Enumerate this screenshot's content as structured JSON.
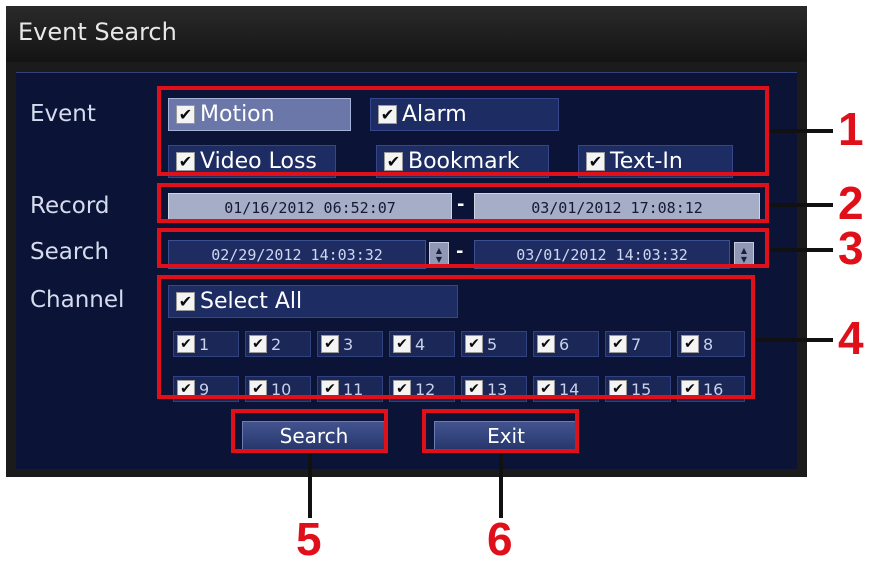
{
  "window": {
    "title": "Event Search"
  },
  "labels": {
    "event": "Event",
    "record": "Record",
    "search": "Search",
    "channel": "Channel"
  },
  "event_types": [
    {
      "label": "Motion",
      "checked": true,
      "selected": true
    },
    {
      "label": "Alarm",
      "checked": true
    },
    {
      "label": "Video Loss",
      "checked": true
    },
    {
      "label": "Bookmark",
      "checked": true
    },
    {
      "label": "Text-In",
      "checked": true
    }
  ],
  "record": {
    "start": "01/16/2012 06:52:07",
    "separator": "-",
    "end": "03/01/2012 17:08:12"
  },
  "search_range": {
    "start": "02/29/2012 14:03:32",
    "separator": "-",
    "end": "03/01/2012 14:03:32"
  },
  "channels": {
    "select_all": "Select All",
    "items": [
      "1",
      "2",
      "3",
      "4",
      "5",
      "6",
      "7",
      "8",
      "9",
      "10",
      "11",
      "12",
      "13",
      "14",
      "15",
      "16"
    ]
  },
  "buttons": {
    "search": "Search",
    "exit": "Exit"
  },
  "callouts": [
    "1",
    "2",
    "3",
    "4",
    "5",
    "6"
  ],
  "glyphs": {
    "check": "✔",
    "spin_up": "▲",
    "spin_down": "▼"
  },
  "colors": {
    "panel": "#0b1437",
    "highlight": "#e0101a",
    "titlebar": "#1b1b1b"
  }
}
